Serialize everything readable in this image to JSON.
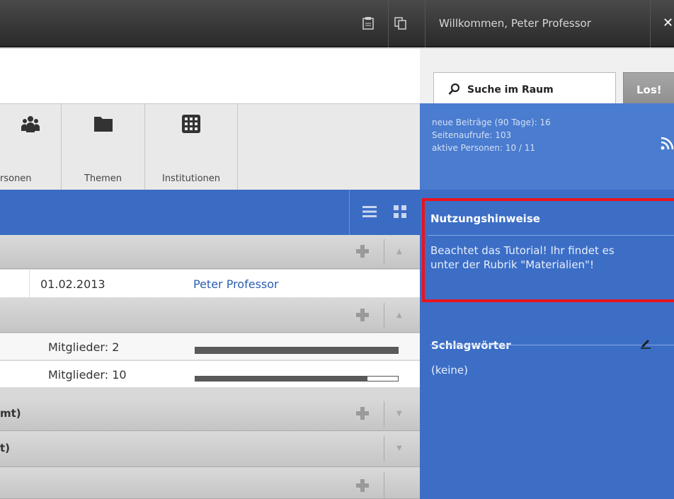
{
  "topbar": {
    "icon1": "clipboard-icon",
    "icon2": "copy-icon",
    "welcome": "Willkommen, Peter Professor",
    "close": "✕"
  },
  "toolbar": {
    "items": [
      {
        "label": "rsonen",
        "icon": "people-icon"
      },
      {
        "label": "Themen",
        "icon": "folder-icon"
      },
      {
        "label": "Institutionen",
        "icon": "grid-icon"
      }
    ]
  },
  "sections": [
    {
      "title": "",
      "has_plus": true,
      "arrow": "▲"
    },
    {
      "title": "",
      "has_plus": true,
      "arrow": "▲"
    },
    {
      "title": "mt)",
      "has_plus": true,
      "arrow": "▼"
    },
    {
      "title": "t)",
      "has_plus": false,
      "arrow": "▼"
    },
    {
      "title": "",
      "has_plus": true,
      "arrow": ""
    }
  ],
  "rows": {
    "row1": {
      "date": "01.02.2013",
      "author": "Peter Professor"
    },
    "row2": {
      "members": "Mitglieder: 2",
      "fill": 1.0
    },
    "row3": {
      "members": "Mitglieder: 10",
      "fill": 0.85
    }
  },
  "search": {
    "placeholder": "Suche im Raum",
    "button": "Los!"
  },
  "stats": {
    "line1": "neue Beiträge (90 Tage): 16",
    "line2": "Seitenaufrufe: 103",
    "line3": "aktive Personen: 10 / 11"
  },
  "notice": {
    "title": "Nutzungshinweise",
    "text1": "Beachtet das Tutorial! Ihr findet es",
    "text2": "unter der Rubrik \"Materialien\"!"
  },
  "tags": {
    "title": "Schlagwörter",
    "empty": "(keine)"
  }
}
